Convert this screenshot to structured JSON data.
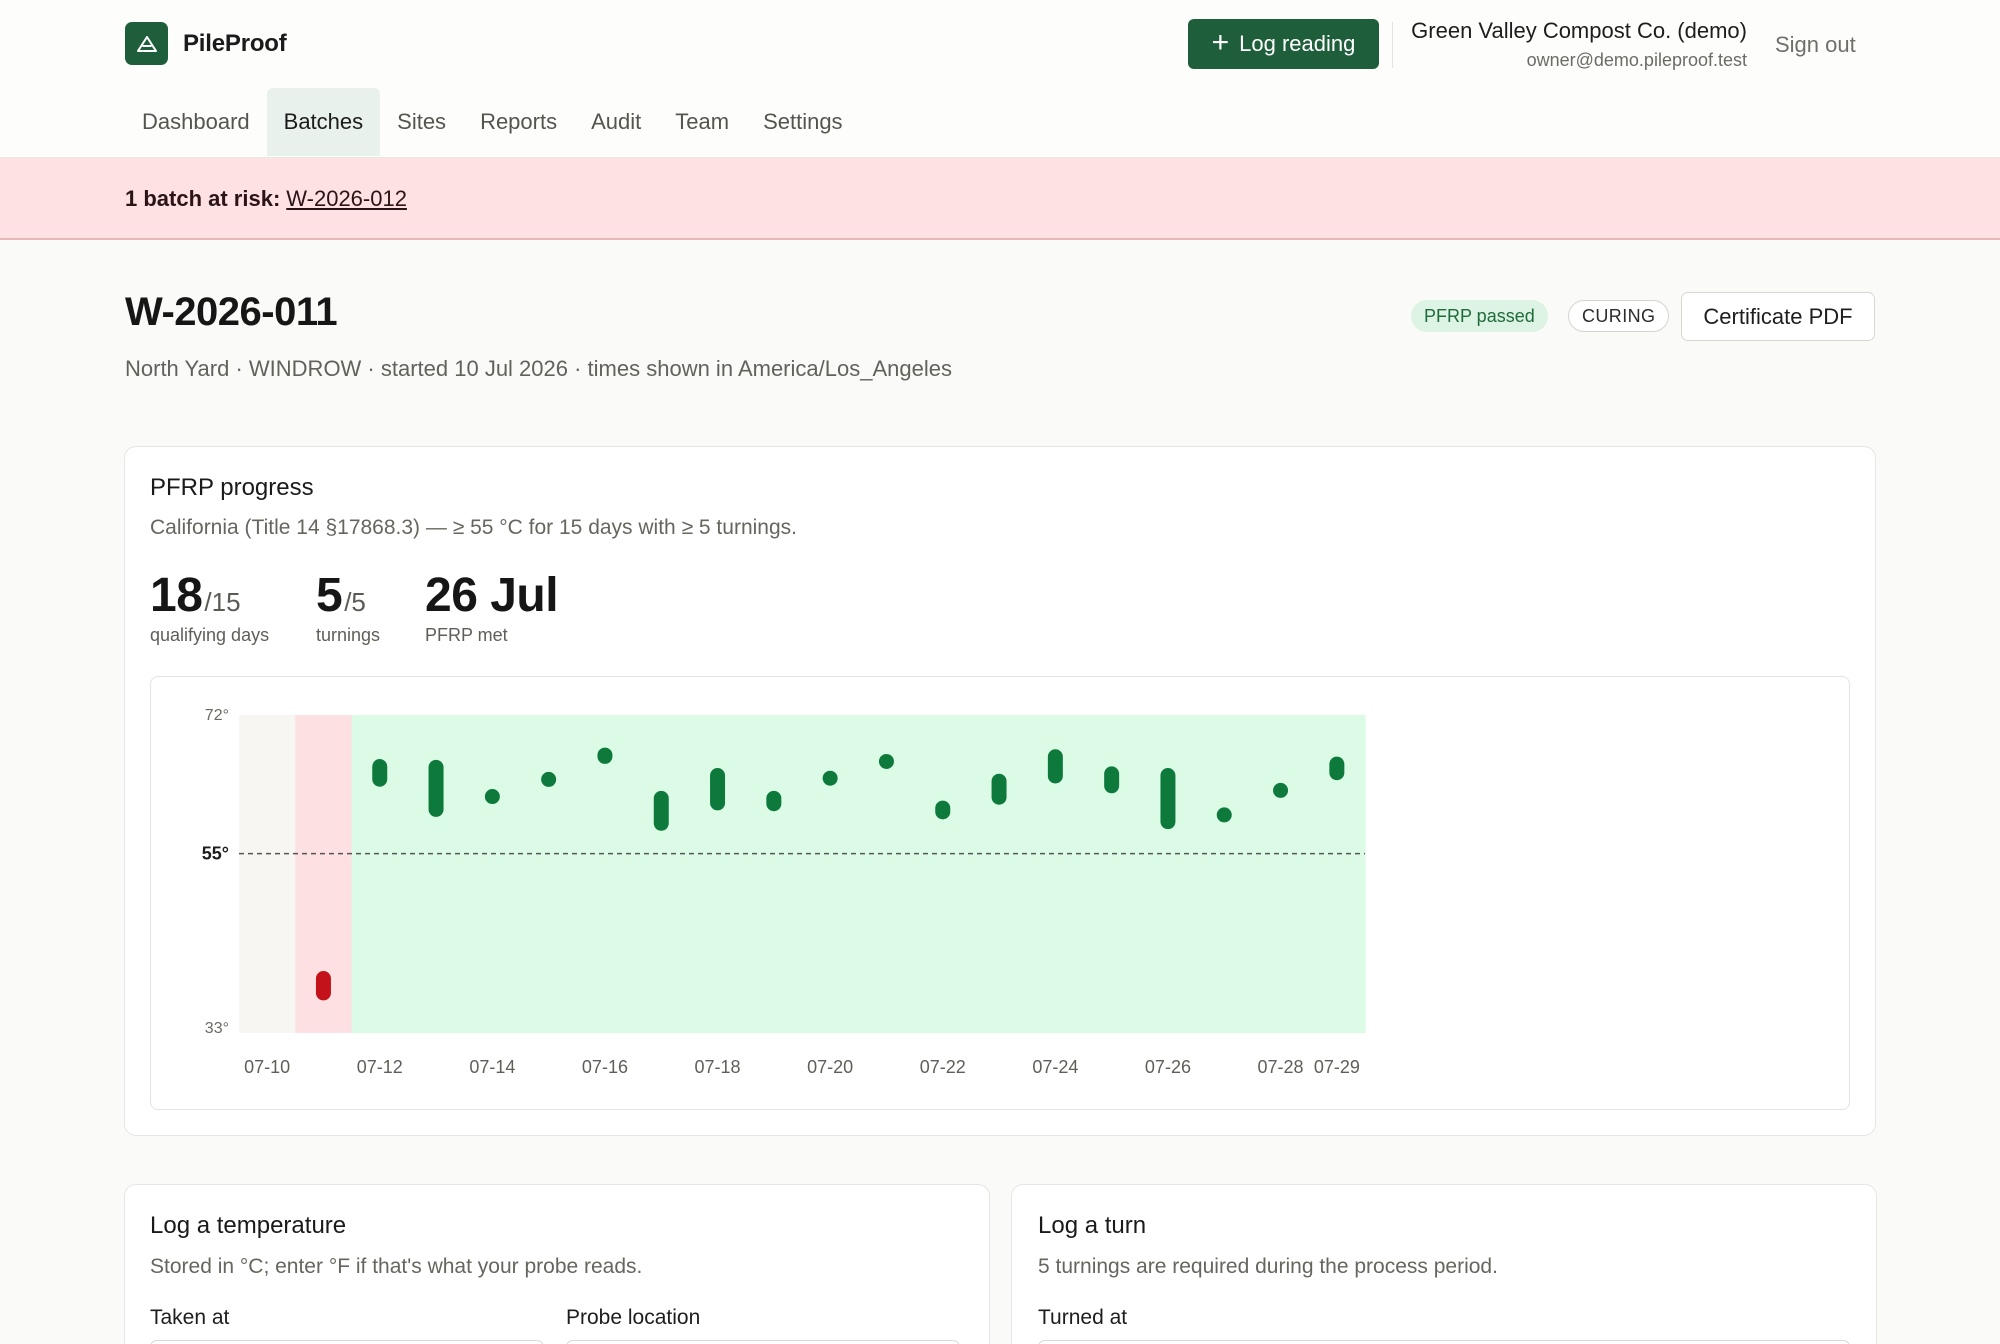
{
  "app": {
    "name": "PileProof",
    "log_reading_label": "Log reading",
    "org_name": "Green Valley Compost Co. (demo)",
    "org_email": "owner@demo.pileproof.test",
    "sign_out_label": "Sign out"
  },
  "nav": {
    "items": [
      {
        "label": "Dashboard",
        "active": false
      },
      {
        "label": "Batches",
        "active": true
      },
      {
        "label": "Sites",
        "active": false
      },
      {
        "label": "Reports",
        "active": false
      },
      {
        "label": "Audit",
        "active": false
      },
      {
        "label": "Team",
        "active": false
      },
      {
        "label": "Settings",
        "active": false
      }
    ]
  },
  "alert": {
    "prefix": "1 batch at risk:",
    "link_label": "W-2026-012"
  },
  "batch": {
    "id": "W-2026-011",
    "meta": "North Yard · WINDROW · started 10 Jul 2026 · times shown in America/Los_Angeles",
    "status_badge": "PFRP passed",
    "phase_badge": "CURING",
    "certificate_label": "Certificate PDF"
  },
  "pfrp": {
    "title": "PFRP progress",
    "subtitle": "California (Title 14 §17868.3) — ≥ 55 °C for 15 days with ≥ 5 turnings.",
    "stats": [
      {
        "value": "18",
        "total": "/15",
        "label": "qualifying days"
      },
      {
        "value": "5",
        "total": "/5",
        "label": "turnings"
      },
      {
        "value": "26 Jul",
        "total": "",
        "label": "PFRP met"
      }
    ]
  },
  "chart_data": {
    "type": "range-bar",
    "y_ticks": [
      "72°",
      "55°",
      "33°"
    ],
    "ylim": [
      33,
      72
    ],
    "threshold": 55,
    "threshold_label": "55°",
    "x_ticks": [
      "07-10",
      "07-12",
      "07-14",
      "07-16",
      "07-18",
      "07-20",
      "07-22",
      "07-24",
      "07-26",
      "07-28",
      "07-29"
    ],
    "days": [
      "07-10",
      "07-11",
      "07-12",
      "07-13",
      "07-14",
      "07-15",
      "07-16",
      "07-17",
      "07-18",
      "07-19",
      "07-20",
      "07-21",
      "07-22",
      "07-23",
      "07-24",
      "07-25",
      "07-26",
      "07-27",
      "07-28",
      "07-29"
    ],
    "day_status": [
      "none",
      "fail",
      "pass",
      "pass",
      "pass",
      "pass",
      "pass",
      "pass",
      "pass",
      "pass",
      "pass",
      "pass",
      "pass",
      "pass",
      "pass",
      "pass",
      "pass",
      "pass",
      "pass",
      "pass"
    ],
    "readings": [
      {
        "day": "07-11",
        "min": 37.0,
        "max": 40.6,
        "status": "fail"
      },
      {
        "day": "07-12",
        "min": 63.2,
        "max": 66.6,
        "status": "pass"
      },
      {
        "day": "07-13",
        "min": 59.5,
        "max": 66.5,
        "status": "pass"
      },
      {
        "day": "07-14",
        "min": 61.8,
        "max": 62.2,
        "status": "pass"
      },
      {
        "day": "07-15",
        "min": 63.2,
        "max": 65.0,
        "status": "pass"
      },
      {
        "day": "07-16",
        "min": 66.0,
        "max": 68.0,
        "status": "pass"
      },
      {
        "day": "07-17",
        "min": 57.8,
        "max": 62.7,
        "status": "pass"
      },
      {
        "day": "07-18",
        "min": 60.3,
        "max": 65.5,
        "status": "pass"
      },
      {
        "day": "07-19",
        "min": 60.2,
        "max": 62.7,
        "status": "pass"
      },
      {
        "day": "07-20",
        "min": 63.5,
        "max": 65.0,
        "status": "pass"
      },
      {
        "day": "07-21",
        "min": 66.0,
        "max": 66.6,
        "status": "pass"
      },
      {
        "day": "07-22",
        "min": 59.2,
        "max": 61.5,
        "status": "pass"
      },
      {
        "day": "07-23",
        "min": 61.0,
        "max": 64.8,
        "status": "pass"
      },
      {
        "day": "07-24",
        "min": 63.6,
        "max": 67.8,
        "status": "pass"
      },
      {
        "day": "07-25",
        "min": 62.4,
        "max": 65.7,
        "status": "pass"
      },
      {
        "day": "07-26",
        "min": 58.0,
        "max": 65.5,
        "status": "pass"
      },
      {
        "day": "07-27",
        "min": 59.5,
        "max": 60.0,
        "status": "pass"
      },
      {
        "day": "07-28",
        "min": 62.0,
        "max": 63.5,
        "status": "pass"
      },
      {
        "day": "07-29",
        "min": 64.0,
        "max": 66.9,
        "status": "pass"
      }
    ],
    "colors": {
      "pass_bg": "#dcfbe7",
      "fail_bg": "#fde0e2",
      "none_bg": "#f7f6f2",
      "pass_bar": "#0d7a3c",
      "fail_bar": "#c4121a"
    }
  },
  "log_temp": {
    "title": "Log a temperature",
    "subtitle": "Stored in °C; enter °F if that's what your probe reads.",
    "taken_at_label": "Taken at",
    "probe_location_label": "Probe location"
  },
  "log_turn": {
    "title": "Log a turn",
    "subtitle": "5 turnings are required during the process period.",
    "turned_at_label": "Turned at"
  }
}
